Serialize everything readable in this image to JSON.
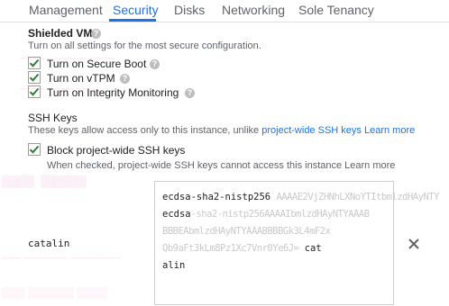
{
  "tabs": [
    {
      "label": "Management"
    },
    {
      "label": "Security"
    },
    {
      "label": "Disks"
    },
    {
      "label": "Networking"
    },
    {
      "label": "Sole Tenancy"
    }
  ],
  "active_tab": "Security",
  "shielded_vm": {
    "heading": "Shielded VM",
    "description": "Turn on all settings for the most secure configuration.",
    "options": [
      {
        "label": "Turn on Secure Boot",
        "checked": true
      },
      {
        "label": "Turn on vTPM",
        "checked": true
      },
      {
        "label": "Turn on Integrity Monitoring",
        "checked": true
      }
    ]
  },
  "ssh_keys": {
    "heading": "SSH Keys",
    "description_prefix": "These keys allow access only to this instance, unlike ",
    "project_wide_link": "project-wide SSH keys",
    "learn_more": "Learn more",
    "block_label": "Block project-wide SSH keys",
    "block_checked": true,
    "block_help_prefix": "When checked, project-wide SSH keys cannot access this instance ",
    "block_learn_more": "Learn more",
    "entry": {
      "username": "catalin",
      "key_lines": [
        {
          "text": "ecdsa-sha2-nistp256 ",
          "blur": "AAAAE2VjZHNhLXNoYTItbmlzdHAyNTY"
        },
        {
          "text": "ecdsa",
          "blur": "-sha2-nistp256AAAAIbmlzdHAyNTYAAAB"
        },
        {
          "text": "",
          "blur": "BBBEAbmlzdHAyNTYAAABBBBGk3L4mF2x"
        },
        {
          "text": "",
          "blur": "Qb9aFt3kLm8Pz1Xc7Vnr0Ye6J=",
          "tail": " cat"
        },
        {
          "text": "alin",
          "blur": ""
        }
      ]
    }
  }
}
